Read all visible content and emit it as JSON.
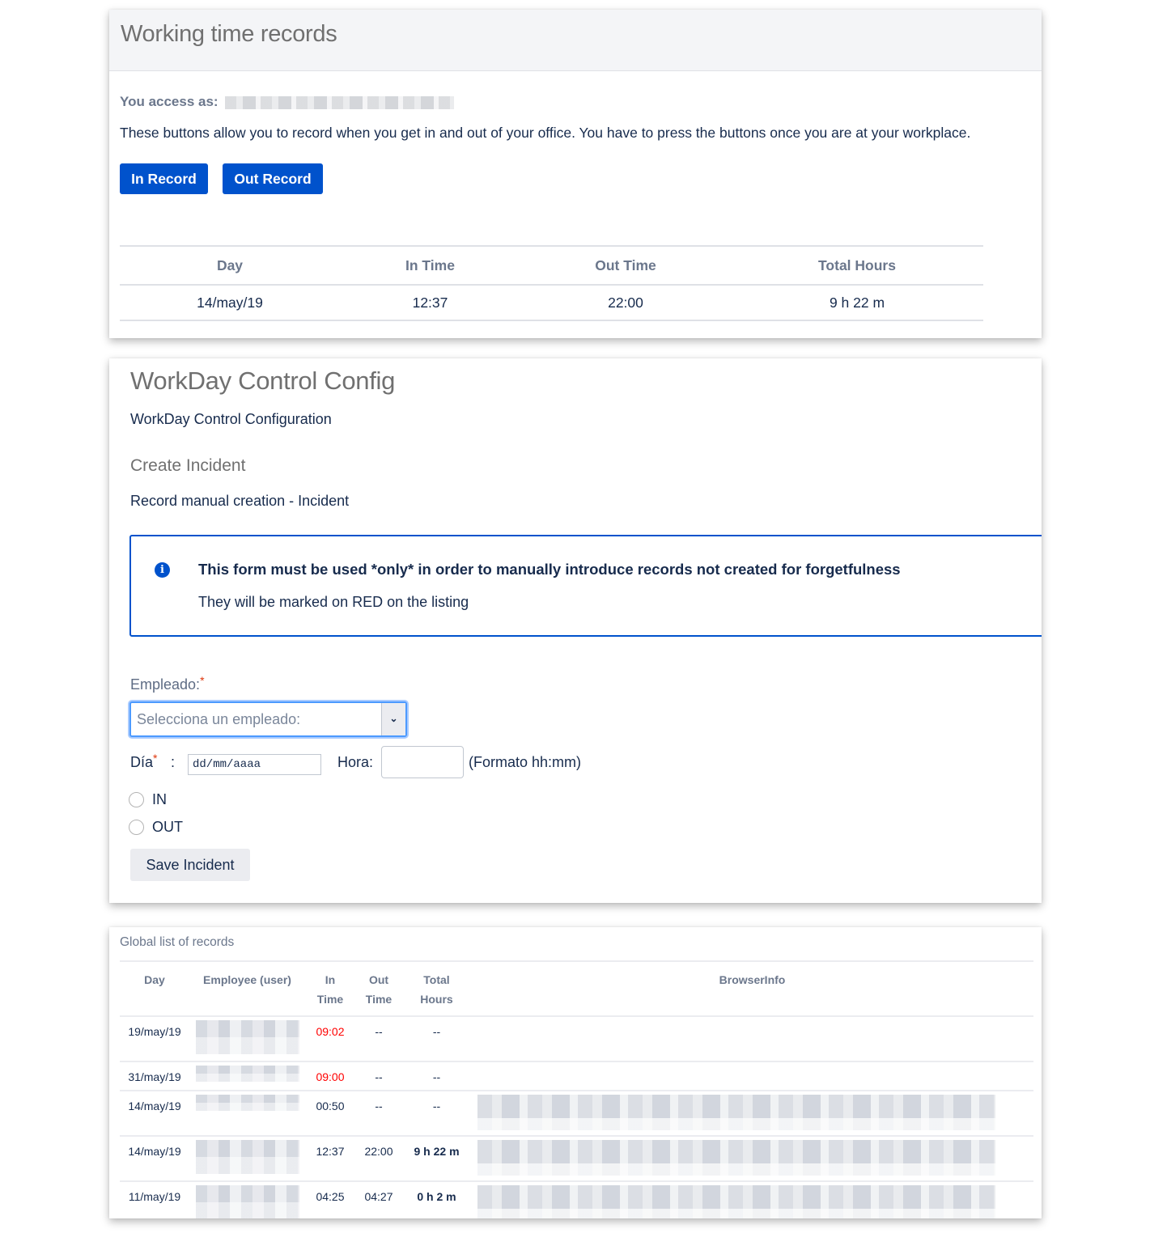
{
  "working_time": {
    "title": "Working time records",
    "access_label": "You access as:",
    "description": "These buttons allow you to record when you get in and out of your office. You have to press the buttons once you are at your workplace.",
    "buttons": {
      "in": "In Record",
      "out": "Out Record"
    },
    "table": {
      "headers": [
        "Day",
        "In Time",
        "Out Time",
        "Total Hours"
      ],
      "rows": [
        {
          "day": "14/may/19",
          "in": "12:37",
          "out": "22:00",
          "total": "9 h 22 m"
        }
      ]
    }
  },
  "config": {
    "title": "WorkDay Control Config",
    "subtitle": "WorkDay Control Configuration",
    "section_title": "Create Incident",
    "section_desc": "Record manual creation - Incident",
    "info": {
      "icon": "info-icon",
      "title": "This form must be used *only* in order to manually introduce records not created for forgetfulness",
      "text": "They will be marked on RED on the listing"
    },
    "form": {
      "employee_label": "Empleado:",
      "required_mark": "*",
      "employee_placeholder": "Selecciona un empleado:",
      "day_label": "Día",
      "colon": ":",
      "day_placeholder": "dd/mm/aaaa",
      "hour_label": "Hora:",
      "hour_value": "",
      "hour_format": "(Formato hh:mm)",
      "radio_in": "IN",
      "radio_out": "OUT",
      "save_button": "Save Incident"
    }
  },
  "global_list": {
    "title": "Global list of records",
    "headers": {
      "day": "Day",
      "employee": "Employee (user)",
      "in_1": "In",
      "in_2": "Time",
      "out_1": "Out",
      "out_2": "Time",
      "total_1": "Total",
      "total_2": "Hours",
      "browser": "BrowserInfo"
    },
    "rows": [
      {
        "day": "19/may/19",
        "in": "09:02",
        "out": "--",
        "total": "--",
        "manual": true
      },
      {
        "day": "31/may/19",
        "in": "09:00",
        "out": "--",
        "total": "--",
        "manual": true
      },
      {
        "day": "14/may/19",
        "in": "00:50",
        "out": "--",
        "total": "--",
        "manual": false
      },
      {
        "day": "14/may/19",
        "in": "12:37",
        "out": "22:00",
        "total": "9 h 22 m",
        "manual": false
      },
      {
        "day": "11/may/19",
        "in": "04:25",
        "out": "04:27",
        "total": "0 h 2 m",
        "manual": false
      }
    ],
    "colors": {
      "manual_in": "#ff0000"
    }
  }
}
